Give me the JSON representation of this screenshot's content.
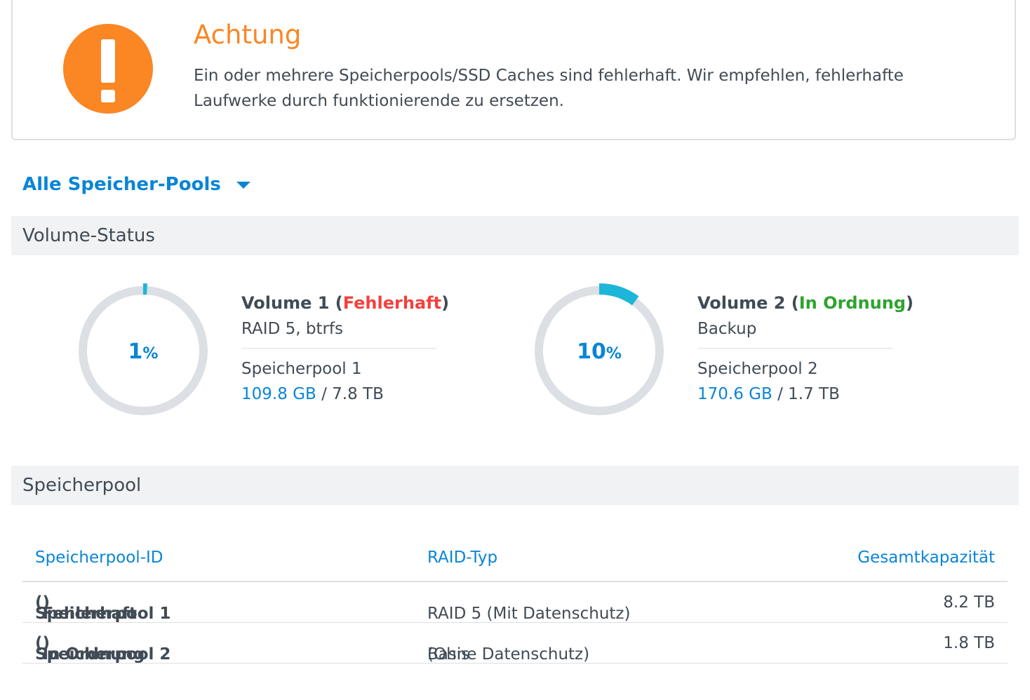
{
  "alert": {
    "title": "Achtung",
    "message": "Ein oder mehrere Speicherpools/SSD Caches sind fehlerhaft. Wir empfehlen, fehlerhafte Laufwerke durch funktionierende zu ersetzen."
  },
  "pool_selector": {
    "label": "Alle Speicher-Pools"
  },
  "volume_status": {
    "heading": "Volume-Status"
  },
  "volumes": [
    {
      "percent_value": 1,
      "percent_symbol": "%",
      "name": "Volume 1",
      "status": "Fehlerhaft",
      "status_color": "#f2413f",
      "subtitle": "RAID 5, btrfs",
      "pool": "Speicherpool 1",
      "used": "109.8 GB",
      "separator": "/",
      "total": "7.8 TB"
    },
    {
      "percent_value": 10,
      "percent_symbol": "%",
      "name": "Volume 2",
      "status": "In Ordnung",
      "status_color": "#2ea32e",
      "subtitle": "Backup",
      "pool": "Speicherpool 2",
      "used": "170.6 GB",
      "separator": "/",
      "total": "1.7 TB"
    }
  ],
  "storage_pool": {
    "heading": "Speicherpool",
    "columns": [
      "Speicherpool-ID",
      "RAID-Typ",
      "Gesamtkapazität"
    ],
    "rows": [
      {
        "name": "Speicherpool 1",
        "status": "Fehlerhaft",
        "raid_main": "RAID 5 (Mit Datenschutz)",
        "raid_extra": "",
        "capacity": "8.2 TB"
      },
      {
        "name": "Speicherpool 2",
        "status": "In Ordnung",
        "raid_main": "Basis",
        "raid_extra": "(Ohne Datenschutz)",
        "capacity": "1.8 TB"
      }
    ]
  },
  "colors": {
    "accent": "#0a85d6",
    "warning": "#fb8624",
    "error": "#f2413f",
    "ok": "#2ea32e",
    "ring_track": "#dcdfe3",
    "ring_fill": "#1cb6d9"
  },
  "icons": {
    "alert": "exclamation-circle-icon",
    "dropdown": "caret-down-icon"
  }
}
